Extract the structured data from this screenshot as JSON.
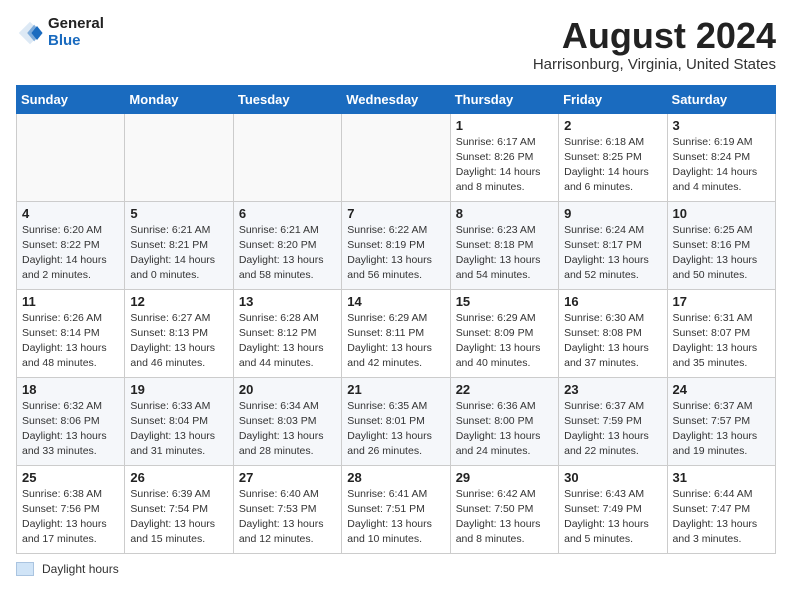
{
  "logo": {
    "general": "General",
    "blue": "Blue"
  },
  "title": "August 2024",
  "location": "Harrisonburg, Virginia, United States",
  "days_header": [
    "Sunday",
    "Monday",
    "Tuesday",
    "Wednesday",
    "Thursday",
    "Friday",
    "Saturday"
  ],
  "legend_label": "Daylight hours",
  "weeks": [
    [
      {
        "num": "",
        "info": ""
      },
      {
        "num": "",
        "info": ""
      },
      {
        "num": "",
        "info": ""
      },
      {
        "num": "",
        "info": ""
      },
      {
        "num": "1",
        "info": "Sunrise: 6:17 AM\nSunset: 8:26 PM\nDaylight: 14 hours\nand 8 minutes."
      },
      {
        "num": "2",
        "info": "Sunrise: 6:18 AM\nSunset: 8:25 PM\nDaylight: 14 hours\nand 6 minutes."
      },
      {
        "num": "3",
        "info": "Sunrise: 6:19 AM\nSunset: 8:24 PM\nDaylight: 14 hours\nand 4 minutes."
      }
    ],
    [
      {
        "num": "4",
        "info": "Sunrise: 6:20 AM\nSunset: 8:22 PM\nDaylight: 14 hours\nand 2 minutes."
      },
      {
        "num": "5",
        "info": "Sunrise: 6:21 AM\nSunset: 8:21 PM\nDaylight: 14 hours\nand 0 minutes."
      },
      {
        "num": "6",
        "info": "Sunrise: 6:21 AM\nSunset: 8:20 PM\nDaylight: 13 hours\nand 58 minutes."
      },
      {
        "num": "7",
        "info": "Sunrise: 6:22 AM\nSunset: 8:19 PM\nDaylight: 13 hours\nand 56 minutes."
      },
      {
        "num": "8",
        "info": "Sunrise: 6:23 AM\nSunset: 8:18 PM\nDaylight: 13 hours\nand 54 minutes."
      },
      {
        "num": "9",
        "info": "Sunrise: 6:24 AM\nSunset: 8:17 PM\nDaylight: 13 hours\nand 52 minutes."
      },
      {
        "num": "10",
        "info": "Sunrise: 6:25 AM\nSunset: 8:16 PM\nDaylight: 13 hours\nand 50 minutes."
      }
    ],
    [
      {
        "num": "11",
        "info": "Sunrise: 6:26 AM\nSunset: 8:14 PM\nDaylight: 13 hours\nand 48 minutes."
      },
      {
        "num": "12",
        "info": "Sunrise: 6:27 AM\nSunset: 8:13 PM\nDaylight: 13 hours\nand 46 minutes."
      },
      {
        "num": "13",
        "info": "Sunrise: 6:28 AM\nSunset: 8:12 PM\nDaylight: 13 hours\nand 44 minutes."
      },
      {
        "num": "14",
        "info": "Sunrise: 6:29 AM\nSunset: 8:11 PM\nDaylight: 13 hours\nand 42 minutes."
      },
      {
        "num": "15",
        "info": "Sunrise: 6:29 AM\nSunset: 8:09 PM\nDaylight: 13 hours\nand 40 minutes."
      },
      {
        "num": "16",
        "info": "Sunrise: 6:30 AM\nSunset: 8:08 PM\nDaylight: 13 hours\nand 37 minutes."
      },
      {
        "num": "17",
        "info": "Sunrise: 6:31 AM\nSunset: 8:07 PM\nDaylight: 13 hours\nand 35 minutes."
      }
    ],
    [
      {
        "num": "18",
        "info": "Sunrise: 6:32 AM\nSunset: 8:06 PM\nDaylight: 13 hours\nand 33 minutes."
      },
      {
        "num": "19",
        "info": "Sunrise: 6:33 AM\nSunset: 8:04 PM\nDaylight: 13 hours\nand 31 minutes."
      },
      {
        "num": "20",
        "info": "Sunrise: 6:34 AM\nSunset: 8:03 PM\nDaylight: 13 hours\nand 28 minutes."
      },
      {
        "num": "21",
        "info": "Sunrise: 6:35 AM\nSunset: 8:01 PM\nDaylight: 13 hours\nand 26 minutes."
      },
      {
        "num": "22",
        "info": "Sunrise: 6:36 AM\nSunset: 8:00 PM\nDaylight: 13 hours\nand 24 minutes."
      },
      {
        "num": "23",
        "info": "Sunrise: 6:37 AM\nSunset: 7:59 PM\nDaylight: 13 hours\nand 22 minutes."
      },
      {
        "num": "24",
        "info": "Sunrise: 6:37 AM\nSunset: 7:57 PM\nDaylight: 13 hours\nand 19 minutes."
      }
    ],
    [
      {
        "num": "25",
        "info": "Sunrise: 6:38 AM\nSunset: 7:56 PM\nDaylight: 13 hours\nand 17 minutes."
      },
      {
        "num": "26",
        "info": "Sunrise: 6:39 AM\nSunset: 7:54 PM\nDaylight: 13 hours\nand 15 minutes."
      },
      {
        "num": "27",
        "info": "Sunrise: 6:40 AM\nSunset: 7:53 PM\nDaylight: 13 hours\nand 12 minutes."
      },
      {
        "num": "28",
        "info": "Sunrise: 6:41 AM\nSunset: 7:51 PM\nDaylight: 13 hours\nand 10 minutes."
      },
      {
        "num": "29",
        "info": "Sunrise: 6:42 AM\nSunset: 7:50 PM\nDaylight: 13 hours\nand 8 minutes."
      },
      {
        "num": "30",
        "info": "Sunrise: 6:43 AM\nSunset: 7:49 PM\nDaylight: 13 hours\nand 5 minutes."
      },
      {
        "num": "31",
        "info": "Sunrise: 6:44 AM\nSunset: 7:47 PM\nDaylight: 13 hours\nand 3 minutes."
      }
    ]
  ]
}
